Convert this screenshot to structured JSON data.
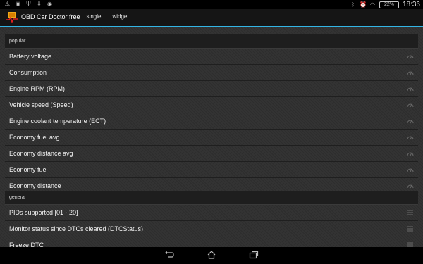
{
  "status_bar": {
    "battery_percent": "22%",
    "time": "18:36"
  },
  "app": {
    "title": "OBD Car Doctor free",
    "tabs": [
      {
        "label": "single",
        "selected": true
      },
      {
        "label": "widget",
        "selected": false
      }
    ],
    "accent_color": "#33b5e5"
  },
  "sections": {
    "popular": {
      "header": "popular",
      "items": [
        "Battery voltage",
        "Consumption",
        "Engine RPM (RPM)",
        "Vehicle speed (Speed)",
        "Engine coolant temperature (ECT)",
        "Economy fuel avg",
        "Economy distance avg",
        "Economy fuel",
        "Economy distance"
      ]
    },
    "general": {
      "header": "general",
      "items": [
        "PIDs supported [01 - 20]",
        "Monitor status since DTCs cleared (DTCStatus)",
        "Freeze DTC"
      ]
    }
  },
  "icons": {
    "popular_row_icon": "gauge-icon",
    "general_row_icon": "list-icon",
    "nav": [
      "back-icon",
      "home-icon",
      "recent-apps-icon"
    ]
  }
}
